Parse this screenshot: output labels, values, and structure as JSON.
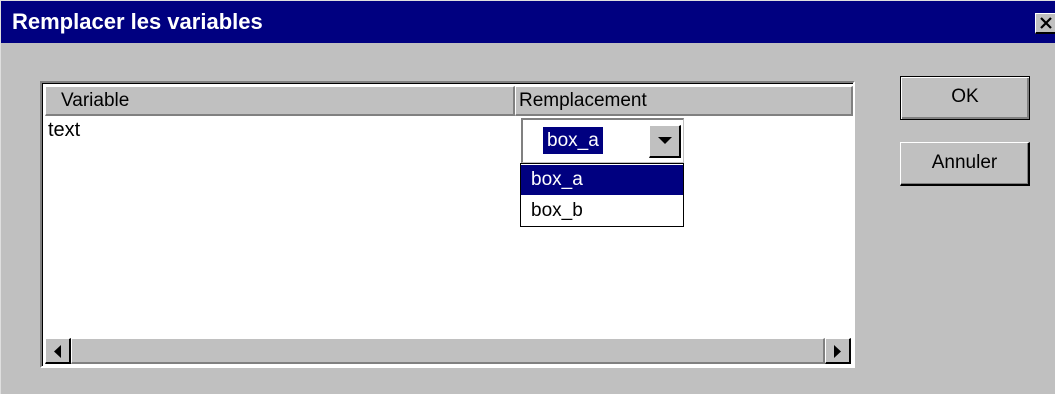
{
  "window": {
    "title": "Remplacer les variables"
  },
  "list": {
    "columns": [
      "Variable",
      "Remplacement"
    ],
    "rows": [
      {
        "variable": "text",
        "replacement": "box_a"
      }
    ]
  },
  "combo": {
    "selected_value": "box_a",
    "options": [
      "box_a",
      "box_b"
    ],
    "highlighted_option": "box_a"
  },
  "buttons": {
    "ok_label": "OK",
    "cancel_label": "Annuler"
  },
  "icons": {
    "close": "close-icon",
    "dropdown": "chevron-down-icon",
    "scroll_left": "arrow-left-icon",
    "scroll_right": "arrow-right-icon"
  },
  "colors": {
    "titlebar": "#000080",
    "face": "#c0c0c0",
    "selection": "#000080"
  }
}
